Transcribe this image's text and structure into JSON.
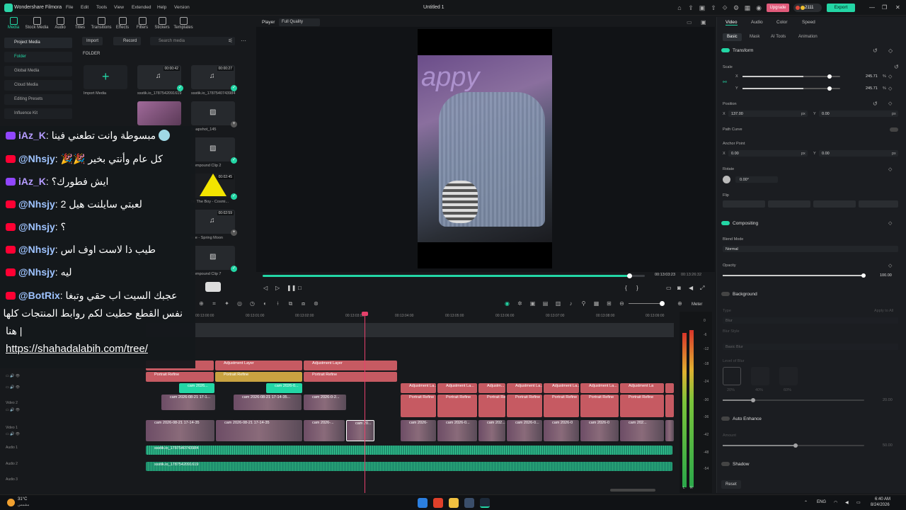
{
  "app": {
    "name": "Wondershare Filmora",
    "project_title": "Untitled 1",
    "upgrade": "Upgrade",
    "credits": "2111",
    "export": "Export"
  },
  "menu": [
    "File",
    "Edit",
    "Tools",
    "View",
    "Extended",
    "Help",
    "Version"
  ],
  "media_tools": [
    "Media",
    "Stock Media",
    "Audio",
    "Titles",
    "Transitions",
    "Effects",
    "Filters",
    "Stickers",
    "Templates"
  ],
  "left_nav": [
    "Project Media",
    "Folder",
    "Global Media",
    "Cloud Media",
    "Editing Presets",
    "Influence Kit"
  ],
  "media_toolbar": {
    "import": "Import",
    "record": "Record",
    "search_placeholder": "Search media",
    "folder_label": "FOLDER"
  },
  "media_items": [
    {
      "caption": "Import Media",
      "dur": ""
    },
    {
      "caption": "ssstik.io_1787542091619",
      "dur": "00:00:42"
    },
    {
      "caption": "ssstik.io_1787540743984",
      "dur": "00:00:27"
    },
    {
      "caption": "",
      "dur": ""
    },
    {
      "caption": "",
      "dur": ""
    },
    {
      "caption": "Snapshot_145",
      "dur": ""
    },
    {
      "caption": "Compound Clip 2",
      "dur": ""
    },
    {
      "caption": "ne The Boy - Cosmi...",
      "dur": "00:02:45"
    },
    {
      "caption": "ave - Spring Moon",
      "dur": "00:02:59"
    },
    {
      "caption": "Compound Clip 7",
      "dur": ""
    }
  ],
  "player": {
    "label": "Player",
    "quality": "Full Quality",
    "time_current": "00:13:03:23",
    "time_total": "00:13:26:32",
    "progress": 0.96
  },
  "right_panel": {
    "tabs": [
      "Video",
      "Audio",
      "Color",
      "Speed"
    ],
    "subtabs": [
      "Basic",
      "Mask",
      "AI Tools",
      "Animation"
    ],
    "transform": "Transform",
    "scale": "Scale",
    "scale_x": "245.71",
    "scale_y": "245.71",
    "pct": "%",
    "position": "Position",
    "pos_x": "137.00",
    "pos_y": "0.00",
    "px": "px",
    "path_curve": "Path Curve",
    "anchor": "Anchor Point",
    "anchor_x": "0.00",
    "anchor_y": "0.00",
    "rotate": "Rotate",
    "rotate_val": "0.00°",
    "flip": "Flip",
    "compositing": "Compositing",
    "blend_mode": "Blend Mode",
    "blend_val": "Normal",
    "opacity": "Opacity",
    "opacity_val": "100.00",
    "background": "Background",
    "bg_type": "Type",
    "bg_apply": "Apply to All",
    "bg_val": "Blur",
    "blur_style": "Blur Style",
    "blur_style_val": "Basic Blur",
    "blur_level": "Level of Blur",
    "blur_levels": [
      "20%",
      "40%",
      "60%"
    ],
    "blur_val": "20.00",
    "auto_enhance": "Auto Enhance",
    "amount": "Amount",
    "amount_val": "50.00",
    "shadow": "Shadow",
    "reset": "Reset",
    "letters": {
      "x": "X",
      "y": "Y"
    }
  },
  "timeline": {
    "ruler": [
      "00:13:00:00",
      "00:13:01:00",
      "00:13:02:00",
      "00:13:03:00",
      "00:13:04:00",
      "00:13:05:00",
      "00:13:06:00",
      "00:13:07:00",
      "00:13:08:00",
      "00:13:09:00"
    ],
    "meter_label": "Meter",
    "meter_ticks": [
      "0",
      "-6",
      "-12",
      "-18",
      "-24",
      "-30",
      "-36",
      "-42",
      "-48",
      "-54"
    ],
    "meter_lr": [
      "L",
      "R"
    ],
    "track_labels": [
      "Video 2",
      "Video 1",
      "Audio 1",
      "Audio 2",
      "Audio 3"
    ],
    "adjustment": "Adjustment Layer",
    "adjustment_short": "Adjustment La...",
    "adjustment_mid": "Adjustment La",
    "adjustment_tiny": "Adjustm...",
    "portrait": "Portrait Refine",
    "cam_short": "cam 2026...",
    "cam_compound": "cam 2026-0...",
    "cam_mid1": "cam 2026-08-21 17-1...",
    "cam_mid2": "cam 2026-08-21 17-14-35...",
    "cam_mid3": "cam 2026-0-2...",
    "cam_long": "cam 2026-08-21 17-14-35",
    "cam_pink": "cam 2026-...",
    "cam_tiny": "cam 20...",
    "cam_b1": "cam 2026-",
    "cam_b2": "cam 202...",
    "cam_b3": "cam 2026-0...",
    "cam_b4": "cam 2026-0...",
    "cam_b5": "cam 2026-0",
    "cam_b6": "cam 2026-0",
    "cam_b7": "cam 202...",
    "audio1": "ssstik.io_1787540743984",
    "audio2": "ssstik.io_1787542091619"
  },
  "chat": [
    {
      "platform": "twitch",
      "user": "iAz_K",
      "text": "مبسوطة وانت تطعني فينا"
    },
    {
      "platform": "youtube",
      "user": "@Nhsjy",
      "text": "كل عام وأنتي بخير 🎉🎉"
    },
    {
      "platform": "twitch",
      "user": "iAz_K",
      "text": "ايش فطورك؟"
    },
    {
      "platform": "youtube",
      "user": "@Nhsjy",
      "text": "لعبتي سايلنت هيل 2"
    },
    {
      "platform": "youtube",
      "user": "@Nhsjy",
      "text": "؟"
    },
    {
      "platform": "youtube",
      "user": "@Nhsjy",
      "text": "طيب ذا لاست اوف اس"
    },
    {
      "platform": "youtube",
      "user": "@Nhsjy",
      "text": "ليه"
    },
    {
      "platform": "youtube",
      "user": "@BotRix",
      "text": "عجبك السيت اب حقي وتبغا"
    }
  ],
  "chat_extra": {
    "line2": "نفس القطع حطيت لكم روابط المنتجات كلها",
    "line3": "هنا |",
    "link": "https://shahadalabih.com/tree/"
  },
  "taskbar": {
    "weather": "31°C",
    "weather_sub": "مشمس",
    "lang": "ENG",
    "time": "6:40 AM",
    "date": "8/24/2026"
  }
}
